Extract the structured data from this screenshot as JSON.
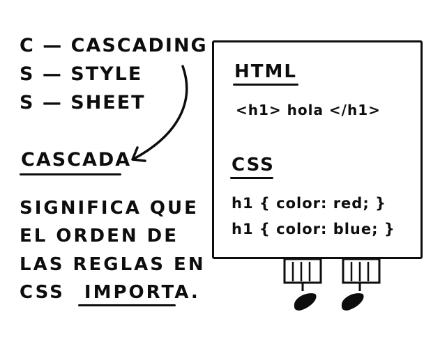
{
  "acronym": {
    "line1": "C — CASCADING",
    "line2": "S — STYLE",
    "line3": "S — SHEET"
  },
  "cascada": {
    "title": "CASCADA",
    "line1": "SIGNIFICA QUE",
    "line2": "EL ORDEN DE",
    "line3": "LAS REGLAS EN",
    "line4_prefix": "CSS",
    "line4_emphasis": "IMPORTA",
    "line4_suffix": "."
  },
  "board": {
    "html_heading": "HTML",
    "html_code": "<h1> hola </h1>",
    "css_heading": "CSS",
    "css_rule1": "h1 { color: red; }",
    "css_rule2": "h1 { color: blue; }"
  }
}
